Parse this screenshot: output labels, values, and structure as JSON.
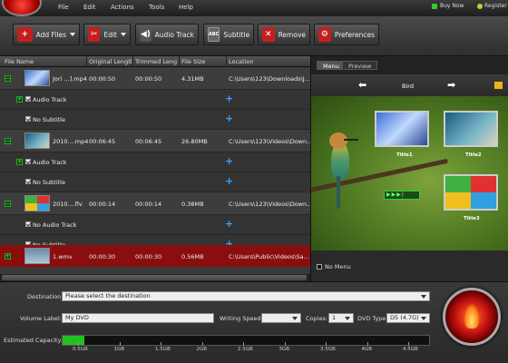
{
  "menu": [
    "File",
    "Edit",
    "Actions",
    "Tools",
    "Help"
  ],
  "topright": {
    "buy": "Buy Now",
    "register": "Register"
  },
  "toolbar": {
    "add_files": "Add Files",
    "edit": "Edit",
    "audio_track": "Audio Track",
    "subtitle": "Subtitle",
    "remove": "Remove",
    "preferences": "Preferences"
  },
  "columns": [
    "File Name",
    "Original Length",
    "Trimmed Length",
    "File Size",
    "Location"
  ],
  "files": [
    {
      "name": "Jori  ...].mp4",
      "original": "00:00:50",
      "trimmed": "00:00:50",
      "size": "4.31MB",
      "location": "C:\\Users\\123\\Downloads\\J...",
      "audio": "Audio Track",
      "subtitle": "No Subtitle"
    },
    {
      "name": "2010....mp4",
      "original": "00:06:45",
      "trimmed": "00:06:45",
      "size": "26.80MB",
      "location": "C:\\Users\\123\\Videos\\Down...",
      "audio": "Audio Track",
      "subtitle": "No Subtitle"
    },
    {
      "name": "2010....flv",
      "original": "00:00:14",
      "trimmed": "00:00:14",
      "size": "0.38MB",
      "location": "C:\\Users\\123\\Videos\\Down...",
      "audio": "No Audio Track",
      "subtitle": "No Subtitle"
    },
    {
      "name": "1.wmv",
      "original": "00:00:30",
      "trimmed": "00:00:30",
      "size": "0.56MB",
      "location": "C:\\Users\\Public\\Videos\\Sa..."
    }
  ],
  "preview": {
    "tabs": [
      "Menu",
      "Preview"
    ],
    "title": "Bird",
    "thumbs": [
      "Title1",
      "Title2",
      "Title3"
    ],
    "no_menu": "No Menu"
  },
  "bottom": {
    "destination_label": "Destination:",
    "destination_value": "Please select the destination",
    "volume_label": "Volume Label:",
    "volume_value": "My DVD",
    "writing_speed_label": "Writing Speed:",
    "copies_label": "Copies:",
    "copies_value": "1",
    "dvd_type_label": "DVD Type:",
    "dvd_type_value": "D5 (4.7G)",
    "capacity_label": "Estimated Capacity:",
    "capacity_fraction": 0.06,
    "ticks": [
      "0.5GB",
      "1GB",
      "1.5GB",
      "2GB",
      "2.5GB",
      "3GB",
      "3.5GB",
      "4GB",
      "4.5GB"
    ]
  }
}
